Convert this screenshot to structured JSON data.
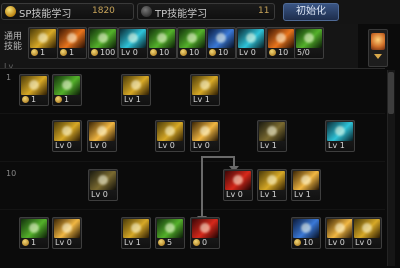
{
  "header": {
    "sp_label": "SP技能学习",
    "sp_value": "1820",
    "tp_label": "TP技能学习",
    "tp_value": "11",
    "reset_label": "初始化"
  },
  "common": {
    "label": "通用技能",
    "level_prefix": "Lv.",
    "skills": [
      {
        "name": "skill-common-1",
        "level": "1",
        "coin": true,
        "color": "c-yel"
      },
      {
        "name": "skill-common-2",
        "level": "1",
        "coin": true,
        "color": "c-orng"
      },
      {
        "name": "skill-common-3",
        "level": "100",
        "coin": true,
        "color": "c-grn"
      },
      {
        "name": "skill-common-4",
        "level": "Lv 0",
        "coin": false,
        "color": "c-cyan"
      },
      {
        "name": "skill-common-5",
        "level": "10",
        "coin": true,
        "color": "c-grn"
      },
      {
        "name": "skill-common-6",
        "level": "10",
        "coin": true,
        "color": "c-grn"
      },
      {
        "name": "skill-common-7",
        "level": "10",
        "coin": true,
        "color": "c-blue"
      },
      {
        "name": "skill-common-8",
        "level": "Lv 0",
        "coin": false,
        "color": "c-cyan"
      },
      {
        "name": "skill-common-9",
        "level": "10",
        "coin": true,
        "color": "c-orng"
      },
      {
        "name": "skill-common-10",
        "level": "5/0",
        "coin": false,
        "color": "c-grn"
      }
    ]
  },
  "tree": {
    "row_labels": [
      "1",
      "10"
    ],
    "rows": [
      [
        {
          "level": "1",
          "coin": true,
          "color": "c-yel"
        },
        {
          "level": "1",
          "coin": true,
          "color": "c-grn"
        },
        {
          "level": "Lv 1",
          "coin": false,
          "color": "c-yel"
        },
        {
          "level": "Lv 1",
          "coin": false,
          "color": "c-yel"
        }
      ],
      [
        {
          "level": "Lv 0",
          "coin": false,
          "color": "c-yel"
        },
        {
          "level": "Lv 0",
          "coin": false,
          "color": "c-gold"
        },
        {
          "level": "Lv 0",
          "coin": false,
          "color": "c-yel"
        },
        {
          "level": "Lv 0",
          "coin": false,
          "color": "c-gold"
        },
        {
          "level": "Lv 1",
          "coin": false,
          "color": "c-dark"
        },
        {
          "level": "Lv 1",
          "coin": false,
          "color": "c-cyan"
        }
      ],
      [
        {
          "level": "Lv 0",
          "coin": false,
          "color": "c-dark"
        },
        {
          "level": "Lv 0",
          "coin": false,
          "color": "c-red"
        },
        {
          "level": "Lv 1",
          "coin": false,
          "color": "c-yel"
        },
        {
          "level": "Lv 1",
          "coin": false,
          "color": "c-gold"
        }
      ],
      [
        {
          "level": "1",
          "coin": true,
          "color": "c-grn"
        },
        {
          "level": "Lv 0",
          "coin": false,
          "color": "c-gold"
        },
        {
          "level": "Lv 1",
          "coin": false,
          "color": "c-yel"
        },
        {
          "level": "5",
          "coin": true,
          "color": "c-grn"
        },
        {
          "level": "0",
          "coin": true,
          "color": "c-red"
        },
        {
          "level": "10",
          "coin": true,
          "color": "c-blue"
        },
        {
          "level": "Lv 0",
          "coin": false,
          "color": "c-gold"
        },
        {
          "level": "Lv 0",
          "coin": false,
          "color": "c-yel"
        }
      ]
    ]
  }
}
